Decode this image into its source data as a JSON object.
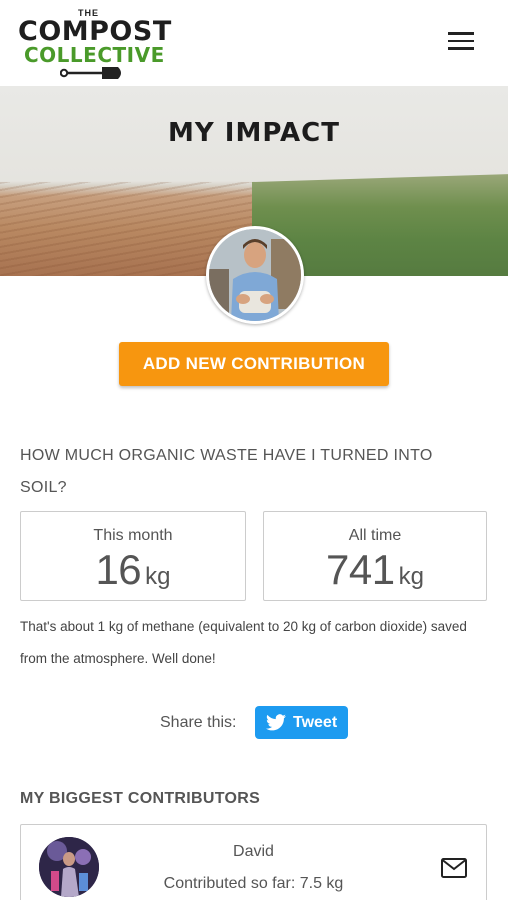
{
  "header": {
    "logo": {
      "line1": "THE",
      "line2": "COMPOST",
      "line3": "COLLECTIVE"
    },
    "menu_icon": "hamburger-menu-icon"
  },
  "hero": {
    "title": "MY IMPACT"
  },
  "actions": {
    "add_contribution_label": "ADD NEW CONTRIBUTION"
  },
  "impact": {
    "question": "HOW MUCH ORGANIC WASTE HAVE I TURNED INTO SOIL?",
    "this_month": {
      "label": "This month",
      "value": "16",
      "unit": "kg"
    },
    "all_time": {
      "label": "All time",
      "value": "741",
      "unit": "kg"
    },
    "summary": "That's about 1 kg of methane (equivalent to 20 kg of carbon dioxide) saved from the atmosphere. Well done!"
  },
  "share": {
    "label": "Share this:",
    "tweet_label": "Tweet",
    "tweet_color": "#1d9bf0"
  },
  "contributors": {
    "heading": "MY BIGGEST CONTRIBUTORS",
    "items": [
      {
        "name": "David",
        "amount_text": "Contributed so far: 7.5 kg",
        "action_icon": "mail-icon"
      }
    ]
  },
  "colors": {
    "accent": "#f7960f",
    "brand_green": "#4a9a2a"
  }
}
